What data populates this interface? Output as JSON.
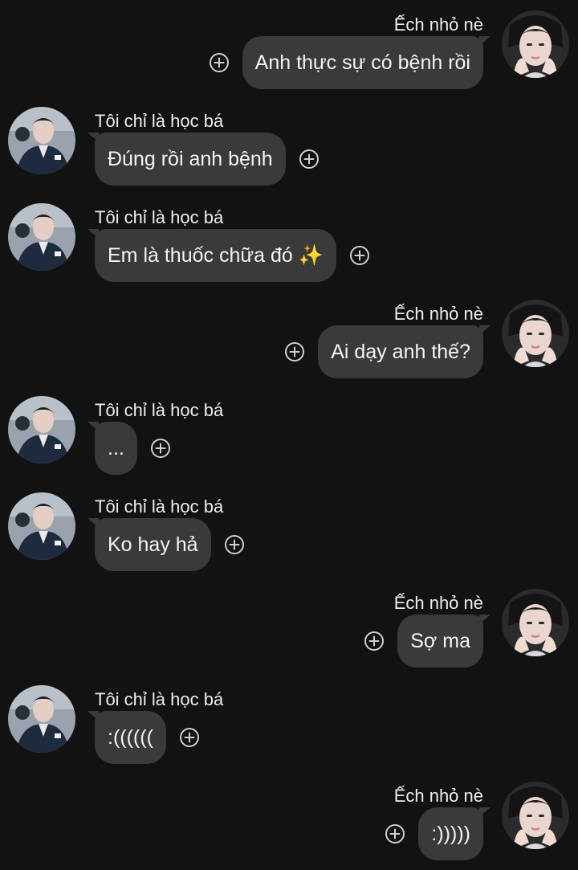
{
  "contacts": {
    "me": {
      "name": "Ếch nhỏ nè",
      "avatar_icon": "profile-photo-hands-on-cheeks"
    },
    "other": {
      "name": "Tôi chỉ là học bá",
      "avatar_icon": "profile-photo-dark-suit"
    }
  },
  "messages": [
    {
      "sender": "Ếch nhỏ nè",
      "text": "Anh thực sự có bệnh rồi"
    },
    {
      "sender": "Tôi chỉ là học bá",
      "text": "Đúng rồi anh bệnh"
    },
    {
      "sender": "Tôi chỉ là học bá",
      "text": "Em là thuốc chữa đó ✨"
    },
    {
      "sender": "Ếch nhỏ nè",
      "text": "Ai dạy anh thế?"
    },
    {
      "sender": "Tôi chỉ là học bá",
      "text": "..."
    },
    {
      "sender": "Tôi chỉ là học bá",
      "text": "Ko hay hả"
    },
    {
      "sender": "Ếch nhỏ nè",
      "text": "Sợ ma"
    },
    {
      "sender": "Tôi chỉ là học bá",
      "text": ":(((((("
    },
    {
      "sender": "Ếch nhỏ nè",
      "text": ":)))))"
    }
  ],
  "icons": {
    "reaction": "add-reaction-icon"
  },
  "colors": {
    "background": "#121212",
    "bubble": "#3a3a3a",
    "text": "#f4f4f4",
    "icon": "#cfcfcf"
  }
}
